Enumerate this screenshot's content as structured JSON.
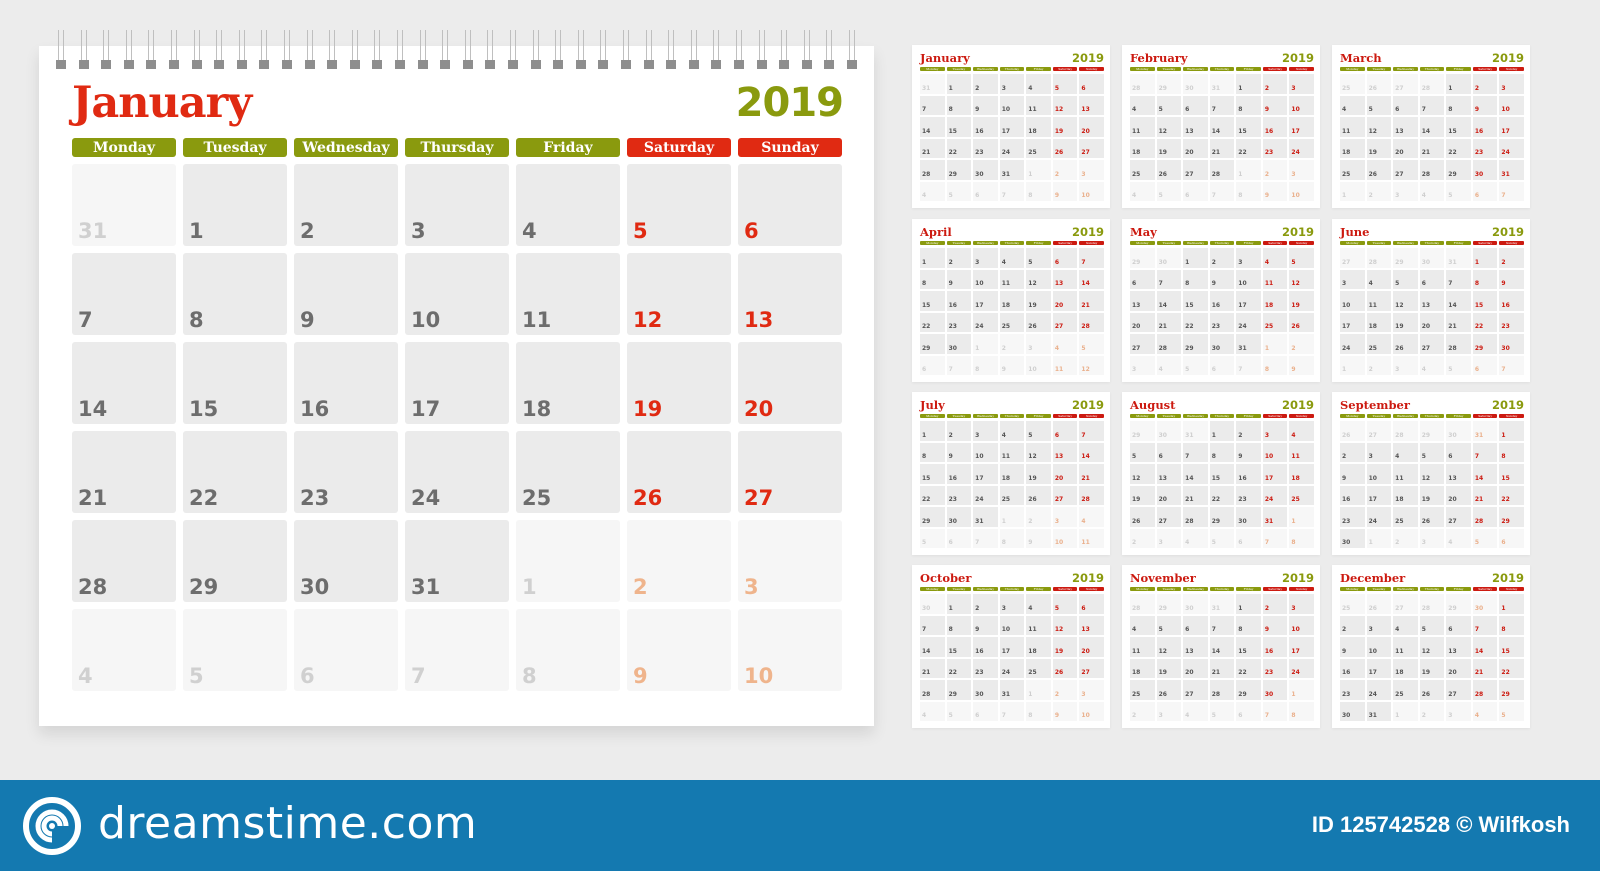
{
  "big_calendar": {
    "month": "January",
    "year": "2019",
    "weekdays": [
      "Monday",
      "Tuesday",
      "Wednesday",
      "Thursday",
      "Friday",
      "Saturday",
      "Sunday"
    ],
    "weeks": [
      [
        {
          "d": "31",
          "out": true
        },
        {
          "d": "1"
        },
        {
          "d": "2"
        },
        {
          "d": "3"
        },
        {
          "d": "4"
        },
        {
          "d": "5"
        },
        {
          "d": "6"
        }
      ],
      [
        {
          "d": "7"
        },
        {
          "d": "8"
        },
        {
          "d": "9"
        },
        {
          "d": "10"
        },
        {
          "d": "11"
        },
        {
          "d": "12"
        },
        {
          "d": "13"
        }
      ],
      [
        {
          "d": "14"
        },
        {
          "d": "15"
        },
        {
          "d": "16"
        },
        {
          "d": "17"
        },
        {
          "d": "18"
        },
        {
          "d": "19"
        },
        {
          "d": "20"
        }
      ],
      [
        {
          "d": "21"
        },
        {
          "d": "22"
        },
        {
          "d": "23"
        },
        {
          "d": "24"
        },
        {
          "d": "25"
        },
        {
          "d": "26"
        },
        {
          "d": "27"
        }
      ],
      [
        {
          "d": "28"
        },
        {
          "d": "29"
        },
        {
          "d": "30"
        },
        {
          "d": "31"
        },
        {
          "d": "1",
          "out": true
        },
        {
          "d": "2",
          "out": true
        },
        {
          "d": "3",
          "out": true
        }
      ],
      [
        {
          "d": "4",
          "out": true
        },
        {
          "d": "5",
          "out": true
        },
        {
          "d": "6",
          "out": true
        },
        {
          "d": "7",
          "out": true
        },
        {
          "d": "8",
          "out": true
        },
        {
          "d": "9",
          "out": true
        },
        {
          "d": "10",
          "out": true
        }
      ]
    ]
  },
  "mini_calendars": [
    {
      "month": "January",
      "year": "2019",
      "lead": [
        "31"
      ],
      "days": 31,
      "trail_count": 10
    },
    {
      "month": "February",
      "year": "2019",
      "lead": [
        "28",
        "29",
        "30",
        "31"
      ],
      "days": 28,
      "trail_count": 10
    },
    {
      "month": "March",
      "year": "2019",
      "lead": [
        "25",
        "26",
        "27",
        "28"
      ],
      "days": 31,
      "trail_count": 7
    },
    {
      "month": "April",
      "year": "2019",
      "lead": [],
      "days": 30,
      "trail_count": 12
    },
    {
      "month": "May",
      "year": "2019",
      "lead": [
        "29",
        "30"
      ],
      "days": 31,
      "trail_count": 9
    },
    {
      "month": "June",
      "year": "2019",
      "lead": [
        "27",
        "28",
        "29",
        "30",
        "31"
      ],
      "days": 30,
      "trail_count": 7
    },
    {
      "month": "July",
      "year": "2019",
      "lead": [],
      "days": 31,
      "trail_count": 11
    },
    {
      "month": "August",
      "year": "2019",
      "lead": [
        "29",
        "30",
        "31"
      ],
      "days": 31,
      "trail_count": 8
    },
    {
      "month": "September",
      "year": "2019",
      "lead": [
        "26",
        "27",
        "28",
        "29",
        "30",
        "31"
      ],
      "days": 30,
      "trail_count": 6
    },
    {
      "month": "October",
      "year": "2019",
      "lead": [
        "30"
      ],
      "days": 31,
      "trail_count": 10
    },
    {
      "month": "November",
      "year": "2019",
      "lead": [
        "28",
        "29",
        "30",
        "31"
      ],
      "days": 30,
      "trail_count": 8
    },
    {
      "month": "December",
      "year": "2019",
      "lead": [
        "25",
        "26",
        "27",
        "28",
        "29",
        "30"
      ],
      "days": 31,
      "trail_count": 5
    }
  ],
  "mini_weekdays": [
    "Monday",
    "Tuesday",
    "Wednesday",
    "Thursday",
    "Friday",
    "Saturday",
    "Sunday"
  ],
  "footer": {
    "brand": "dreamstime.com",
    "credit": "ID 125742528 © Wilfkosh"
  },
  "colors": {
    "weekday_green": "#8a9a0e",
    "weekend_red": "#e02a12",
    "footer_blue": "#1479b0"
  }
}
